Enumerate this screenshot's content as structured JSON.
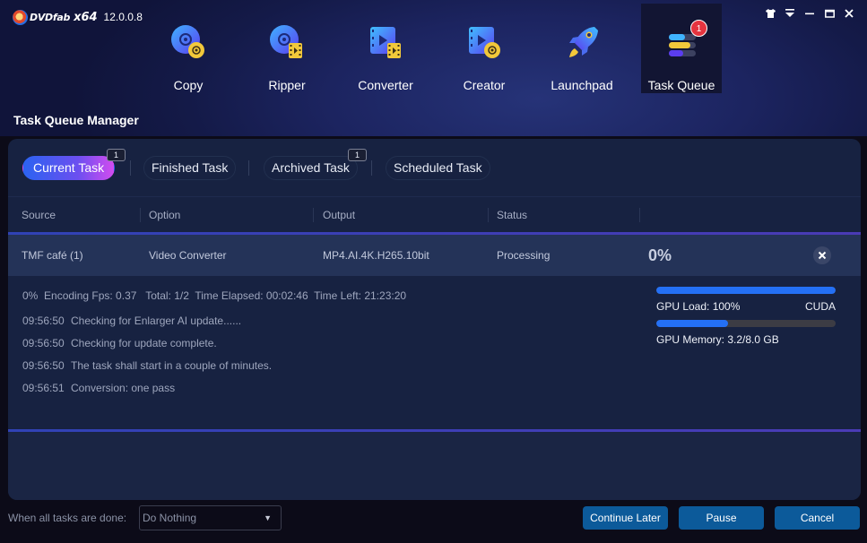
{
  "app": {
    "brand": "DVDfab",
    "arch": "x64",
    "version": "12.0.0.8"
  },
  "window_controls": [
    "skin-icon",
    "menu-icon",
    "minimize-icon",
    "maximize-icon",
    "close-icon"
  ],
  "nav": {
    "items": [
      {
        "label": "Copy",
        "icon": "copy-disc-icon"
      },
      {
        "label": "Ripper",
        "icon": "ripper-disc-icon"
      },
      {
        "label": "Converter",
        "icon": "converter-video-icon"
      },
      {
        "label": "Creator",
        "icon": "creator-video-icon"
      },
      {
        "label": "Launchpad",
        "icon": "rocket-icon"
      },
      {
        "label": "Task Queue",
        "icon": "task-queue-icon",
        "badge": "1",
        "active": true
      }
    ]
  },
  "page_title": "Task Queue Manager",
  "tabs": [
    {
      "label": "Current Task",
      "count": "1",
      "active": true
    },
    {
      "label": "Finished Task"
    },
    {
      "label": "Archived Task",
      "count": "1"
    },
    {
      "label": "Scheduled Task"
    }
  ],
  "columns": [
    "Source",
    "Option",
    "Output",
    "Status"
  ],
  "task": {
    "source": "TMF café (1)",
    "option": "Video Converter",
    "output": "MP4.AI.4K.H265.10bit",
    "status": "Processing",
    "progress": "0%"
  },
  "detail": {
    "stats": "0%  Encoding Fps: 0.37   Total: 1/2  Time Elapsed: 00:02:46  Time Left: 21:23:20",
    "log": [
      {
        "time": "09:56:50",
        "text": "Checking for Enlarger AI update......"
      },
      {
        "time": "09:56:50",
        "text": "Checking for update complete."
      },
      {
        "time": "09:56:50",
        "text": "The task shall start in a couple of minutes."
      },
      {
        "time": "09:56:51",
        "text": "Conversion: one pass"
      }
    ],
    "gpu": {
      "load_label": "GPU Load: 100%",
      "load_fraction": 1.0,
      "engine": "CUDA",
      "memory_label": "GPU Memory: 3.2/8.0 GB",
      "memory_fraction": 0.4
    }
  },
  "footer": {
    "when_done_label": "When all tasks are done:",
    "when_done_value": "Do Nothing",
    "buttons": {
      "continue_later": "Continue Later",
      "pause": "Pause",
      "cancel": "Cancel"
    }
  },
  "colors": {
    "accent_blue": "#2470f5",
    "button_blue": "#0c5a9a",
    "badge_red": "#e4343f"
  }
}
